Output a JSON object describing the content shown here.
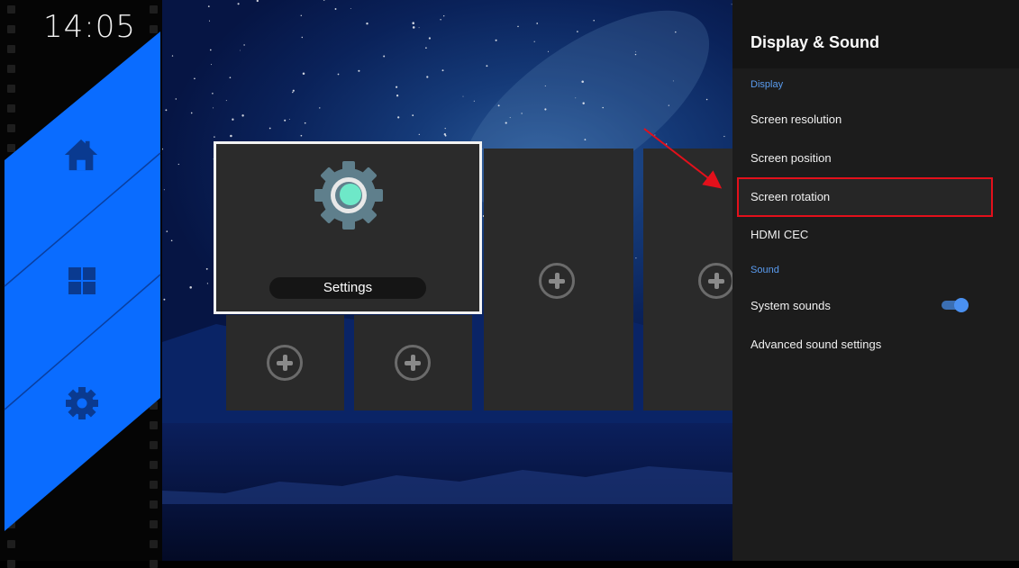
{
  "clock": "14:05",
  "colors": {
    "rail_band": "#0a6cff",
    "highlight": "#e3101b",
    "section": "#5a9cf0",
    "toggle": "#4a90f0"
  },
  "rail": {
    "icons": [
      "home-icon",
      "windows-icon",
      "gear-icon"
    ]
  },
  "tiles": {
    "main_label": "Settings"
  },
  "panel": {
    "title": "Display & Sound",
    "sections": [
      {
        "label": "Display",
        "items": [
          "Screen resolution",
          "Screen position",
          "Screen rotation",
          "HDMI CEC"
        ]
      },
      {
        "label": "Sound",
        "items": [
          "System sounds",
          "Advanced sound settings"
        ]
      }
    ],
    "system_sounds_enabled": true
  }
}
